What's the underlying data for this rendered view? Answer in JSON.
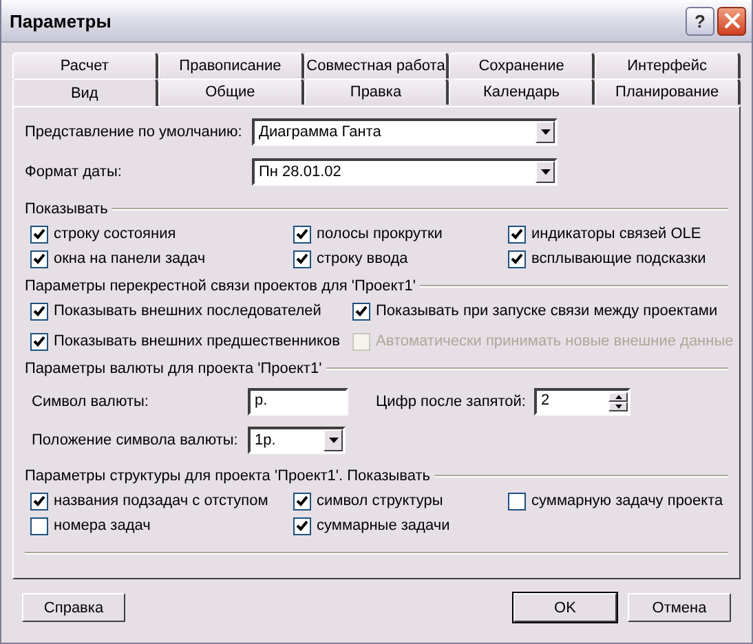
{
  "window": {
    "title": "Параметры",
    "help_button": "?"
  },
  "tab_rows": [
    {
      "tabs": [
        {
          "label": "Расчет",
          "selected": false
        },
        {
          "label": "Правописание",
          "selected": false
        },
        {
          "label": "Совместная работа",
          "selected": false
        },
        {
          "label": "Сохранение",
          "selected": false
        },
        {
          "label": "Интерфейс",
          "selected": false
        }
      ]
    },
    {
      "tabs": [
        {
          "label": "Вид",
          "selected": true
        },
        {
          "label": "Общие",
          "selected": false
        },
        {
          "label": "Правка",
          "selected": false
        },
        {
          "label": "Календарь",
          "selected": false
        },
        {
          "label": "Планирование",
          "selected": false
        }
      ]
    }
  ],
  "dropdowns": [
    {
      "label": "Представление по умолчанию:",
      "value": "Диаграмма Ганта"
    },
    {
      "label": "Формат даты:",
      "value": "Пн 28.01.02"
    }
  ],
  "sections": [
    {
      "kind": "checkboxes3",
      "title": "Показывать",
      "items": [
        {
          "label": "строку состояния",
          "checked": true,
          "disabled": false
        },
        {
          "label": "полосы прокрутки",
          "checked": true,
          "disabled": false
        },
        {
          "label": "индикаторы связей OLE",
          "checked": true,
          "disabled": false
        },
        {
          "label": "окна на панели задач",
          "checked": true,
          "disabled": false
        },
        {
          "label": "строку ввода",
          "checked": true,
          "disabled": false
        },
        {
          "label": "всплывающие подсказки",
          "checked": true,
          "disabled": false
        }
      ]
    },
    {
      "kind": "checkboxes2",
      "title": "Параметры перекрестной связи проектов для 'Проект1'",
      "items": [
        {
          "label": "Показывать внешних последователей",
          "checked": true,
          "disabled": false
        },
        {
          "label": "Показывать при запуске связи между проектами",
          "checked": true,
          "disabled": false
        },
        {
          "label": "Показывать внешних предшественников",
          "checked": true,
          "disabled": false
        },
        {
          "label": "Автоматически принимать новые внешние данные",
          "checked": false,
          "disabled": true
        }
      ]
    },
    {
      "kind": "currency",
      "title": "Параметры валюты для проекта 'Проект1'",
      "symbol": {
        "label": "Символ валюты:",
        "value": "р."
      },
      "digits": {
        "label": "Цифр после запятой:",
        "value": "2"
      },
      "position": {
        "label": "Положение символа валюты:",
        "value": "1р."
      }
    },
    {
      "kind": "checkboxes3",
      "title": "Параметры структуры для проекта 'Проект1'. Показывать",
      "items": [
        {
          "label": "названия подзадач с отступом",
          "checked": true,
          "disabled": false
        },
        {
          "label": "символ структуры",
          "checked": true,
          "disabled": false
        },
        {
          "label": "суммарную задачу проекта",
          "checked": false,
          "disabled": false
        },
        {
          "label": "номера задач",
          "checked": false,
          "disabled": false
        },
        {
          "label": "суммарные задачи",
          "checked": true,
          "disabled": false
        }
      ]
    }
  ],
  "buttons": [
    {
      "label": "Справка",
      "default": false
    },
    {
      "label": "OK",
      "default": true
    },
    {
      "label": "Отмена",
      "default": false
    }
  ]
}
